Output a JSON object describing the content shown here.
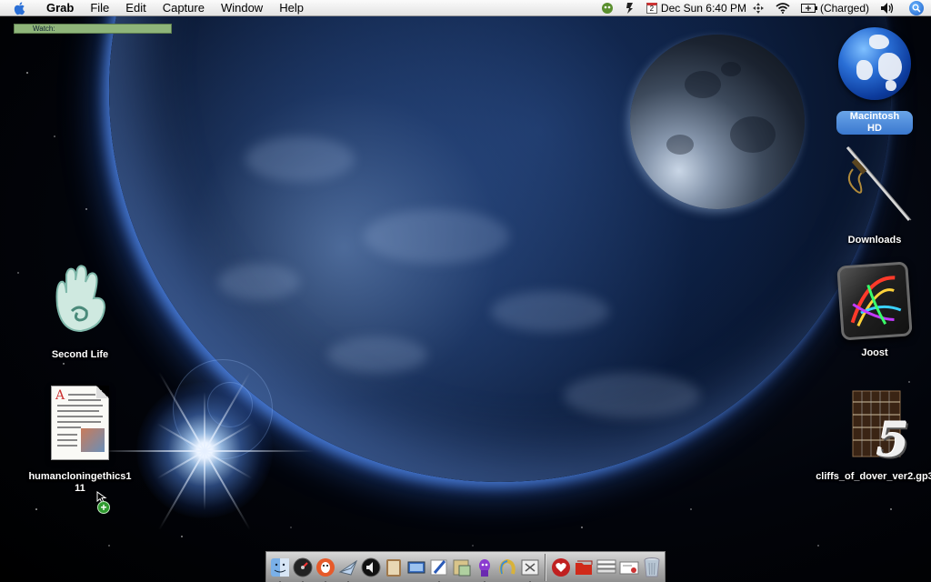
{
  "menubar": {
    "apple_icon": "apple-logo-icon",
    "app_name": "Grab",
    "menus": [
      "File",
      "Edit",
      "Capture",
      "Window",
      "Help"
    ],
    "calendar_day": "2",
    "datetime": "Dec Sun 6:40 PM",
    "battery_status": "(Charged)"
  },
  "watch_bar": {
    "label": "Watch:"
  },
  "desktop": {
    "icons": {
      "macintosh_hd": "Macintosh HD",
      "downloads": "Downloads",
      "joost": "Joost",
      "cliffs": "cliffs_of_dover_ver2.gp3",
      "second_life": "Second Life",
      "document": "humancloningethics111"
    },
    "document_preview_letter": "A",
    "drag_badge": "+",
    "gp_logo_digit": "5"
  },
  "dock": {
    "apps": [
      "finder-icon",
      "dashboard-icon",
      "chat-icon",
      "mail-icon",
      "speaker-icon",
      "address-book-icon",
      "keynote-icon",
      "pen-icon",
      "preview-icon",
      "alien-icon",
      "horseshoe-icon",
      "grab-icon"
    ],
    "stacks": [
      "heart-icon",
      "folder-icon",
      "document-stack-icon",
      "certificate-icon",
      "trash-icon"
    ]
  },
  "colors": {
    "menubar_top": "#fbfbfb",
    "selection_blue": "#3a78cf",
    "watch_green": "#8fb57a"
  }
}
